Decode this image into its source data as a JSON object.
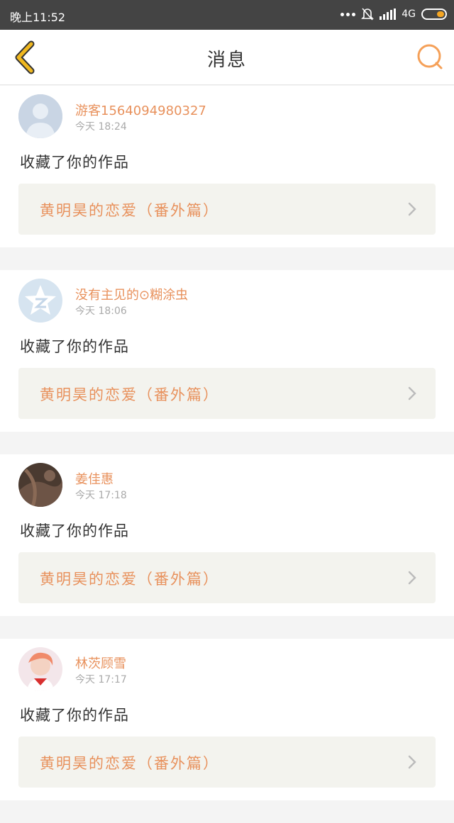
{
  "status_bar": {
    "time": "晚上11:52",
    "network": "4G"
  },
  "header": {
    "title": "消息"
  },
  "colors": {
    "accent": "#e8915c",
    "back_icon": "#f0b820",
    "search_icon": "#f5a058"
  },
  "messages": [
    {
      "username": "游客1564094980327",
      "time": "今天  18:24",
      "action": "收藏了你的作品",
      "work_title": "黄明昊的恋爱（番外篇）",
      "avatar_icon": "default-person-avatar"
    },
    {
      "username": "没有主见的⊙糊涂虫",
      "time": "今天  18:06",
      "action": "收藏了你的作品",
      "work_title": "黄明昊的恋爱（番外篇）",
      "avatar_icon": "qzone-star-avatar"
    },
    {
      "username": "姜佳惠",
      "time": "今天  17:18",
      "action": "收藏了你的作品",
      "work_title": "黄明昊的恋爱（番外篇）",
      "avatar_icon": "photo-avatar"
    },
    {
      "username": "林茨顾雪",
      "time": "今天  17:17",
      "action": "收藏了你的作品",
      "work_title": "黄明昊的恋爱（番外篇）",
      "avatar_icon": "photo-avatar"
    }
  ]
}
